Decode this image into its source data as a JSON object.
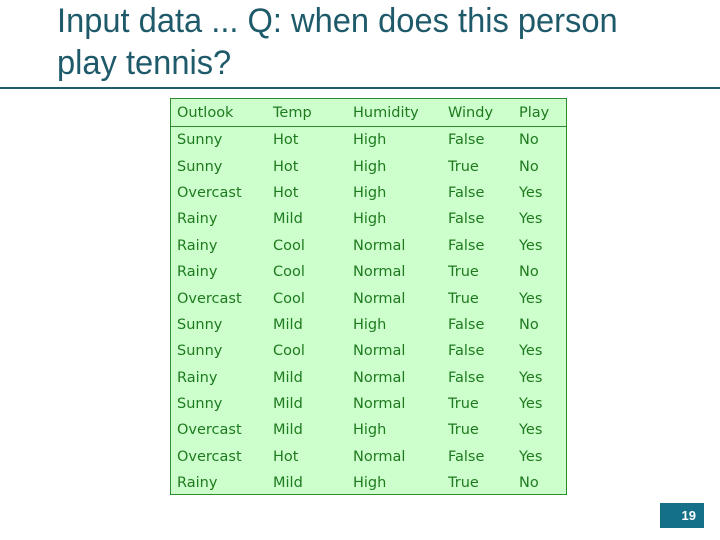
{
  "slide": {
    "title": "Input data ... Q: when does this person play tennis?",
    "page_number": "19"
  },
  "table": {
    "columns": [
      "Outlook",
      "Temp",
      "Humidity",
      "Windy",
      "Play"
    ],
    "rows": [
      [
        "Sunny",
        "Hot",
        "High",
        "False",
        "No"
      ],
      [
        "Sunny",
        "Hot",
        "High",
        "True",
        "No"
      ],
      [
        "Overcast",
        "Hot",
        "High",
        "False",
        "Yes"
      ],
      [
        "Rainy",
        "Mild",
        "High",
        "False",
        "Yes"
      ],
      [
        "Rainy",
        "Cool",
        "Normal",
        "False",
        "Yes"
      ],
      [
        "Rainy",
        "Cool",
        "Normal",
        "True",
        "No"
      ],
      [
        "Overcast",
        "Cool",
        "Normal",
        "True",
        "Yes"
      ],
      [
        "Sunny",
        "Mild",
        "High",
        "False",
        "No"
      ],
      [
        "Sunny",
        "Cool",
        "Normal",
        "False",
        "Yes"
      ],
      [
        "Rainy",
        "Mild",
        "Normal",
        "False",
        "Yes"
      ],
      [
        "Sunny",
        "Mild",
        "Normal",
        "True",
        "Yes"
      ],
      [
        "Overcast",
        "Mild",
        "High",
        "True",
        "Yes"
      ],
      [
        "Overcast",
        "Hot",
        "Normal",
        "False",
        "Yes"
      ],
      [
        "Rainy",
        "Mild",
        "High",
        "True",
        "No"
      ]
    ]
  },
  "colors": {
    "title": "#1e5a6a",
    "table_background": "#ccffcc",
    "table_border": "#2e8b2e",
    "table_text": "#1f7a1f",
    "page_badge": "#137088"
  }
}
